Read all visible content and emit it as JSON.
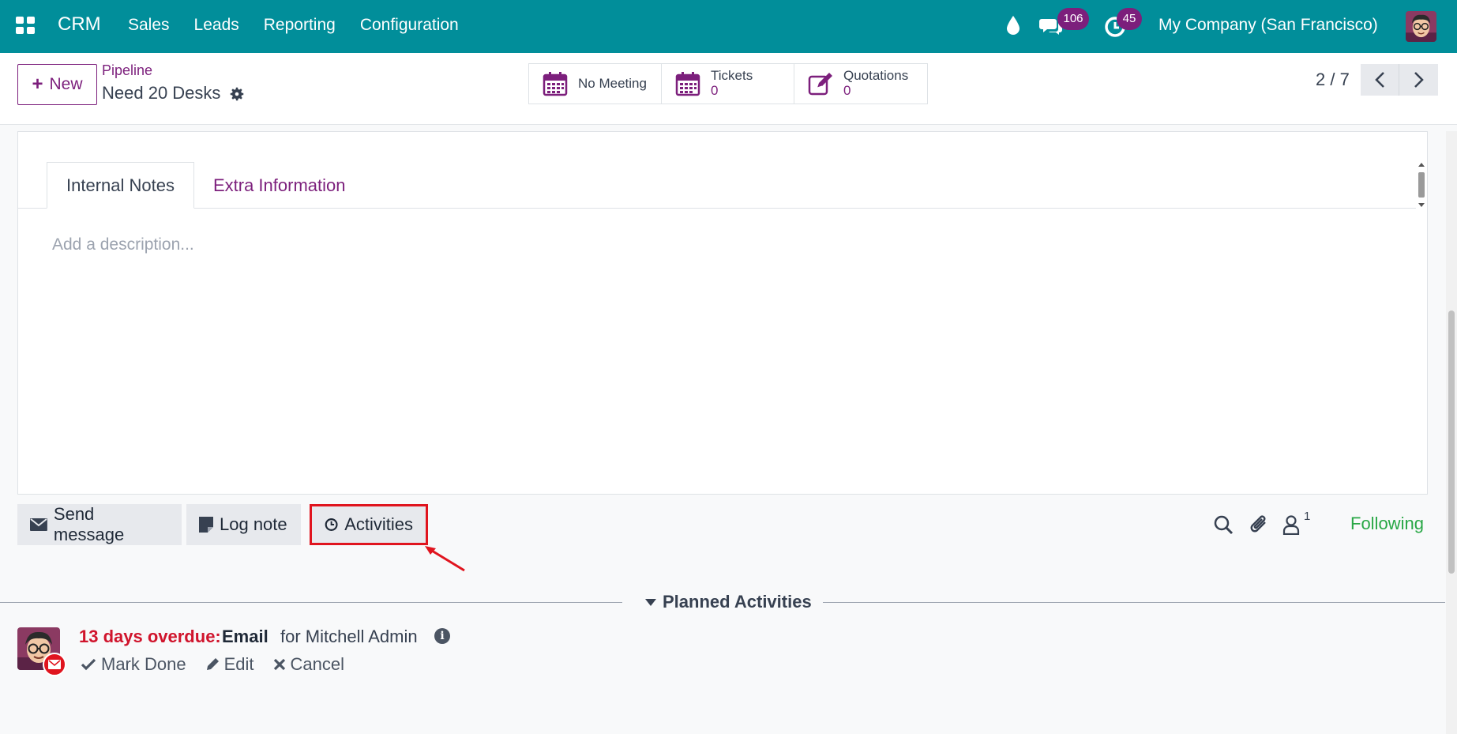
{
  "navbar": {
    "brand": "CRM",
    "menu": [
      "Sales",
      "Leads",
      "Reporting",
      "Configuration"
    ],
    "chat_count": "106",
    "activity_count": "45",
    "company": "My Company (San Francisco)"
  },
  "control": {
    "new_label": "New",
    "breadcrumb": "Pipeline",
    "record_title": "Need 20 Desks",
    "smart_buttons": [
      {
        "label": "No Meeting",
        "value": ""
      },
      {
        "label": "Tickets",
        "value": "0"
      },
      {
        "label": "Quotations",
        "value": "0"
      }
    ],
    "pager": "2 / 7"
  },
  "form": {
    "tabs": [
      "Internal Notes",
      "Extra Information"
    ],
    "description_placeholder": "Add a description..."
  },
  "chatter": {
    "send_message": "Send message",
    "log_note": "Log note",
    "activities": "Activities",
    "follower_count": "1",
    "following": "Following",
    "planned_title": "Planned Activities",
    "activity": {
      "overdue": "13 days overdue:",
      "type": "Email",
      "assignee": "for Mitchell Admin",
      "mark_done": "Mark Done",
      "edit": "Edit",
      "cancel": "Cancel"
    }
  },
  "colors": {
    "navbar": "#018e9a",
    "accent": "#7c1f7c",
    "overdue": "#d0142c",
    "following": "#28a745",
    "highlight": "#e0141e"
  }
}
